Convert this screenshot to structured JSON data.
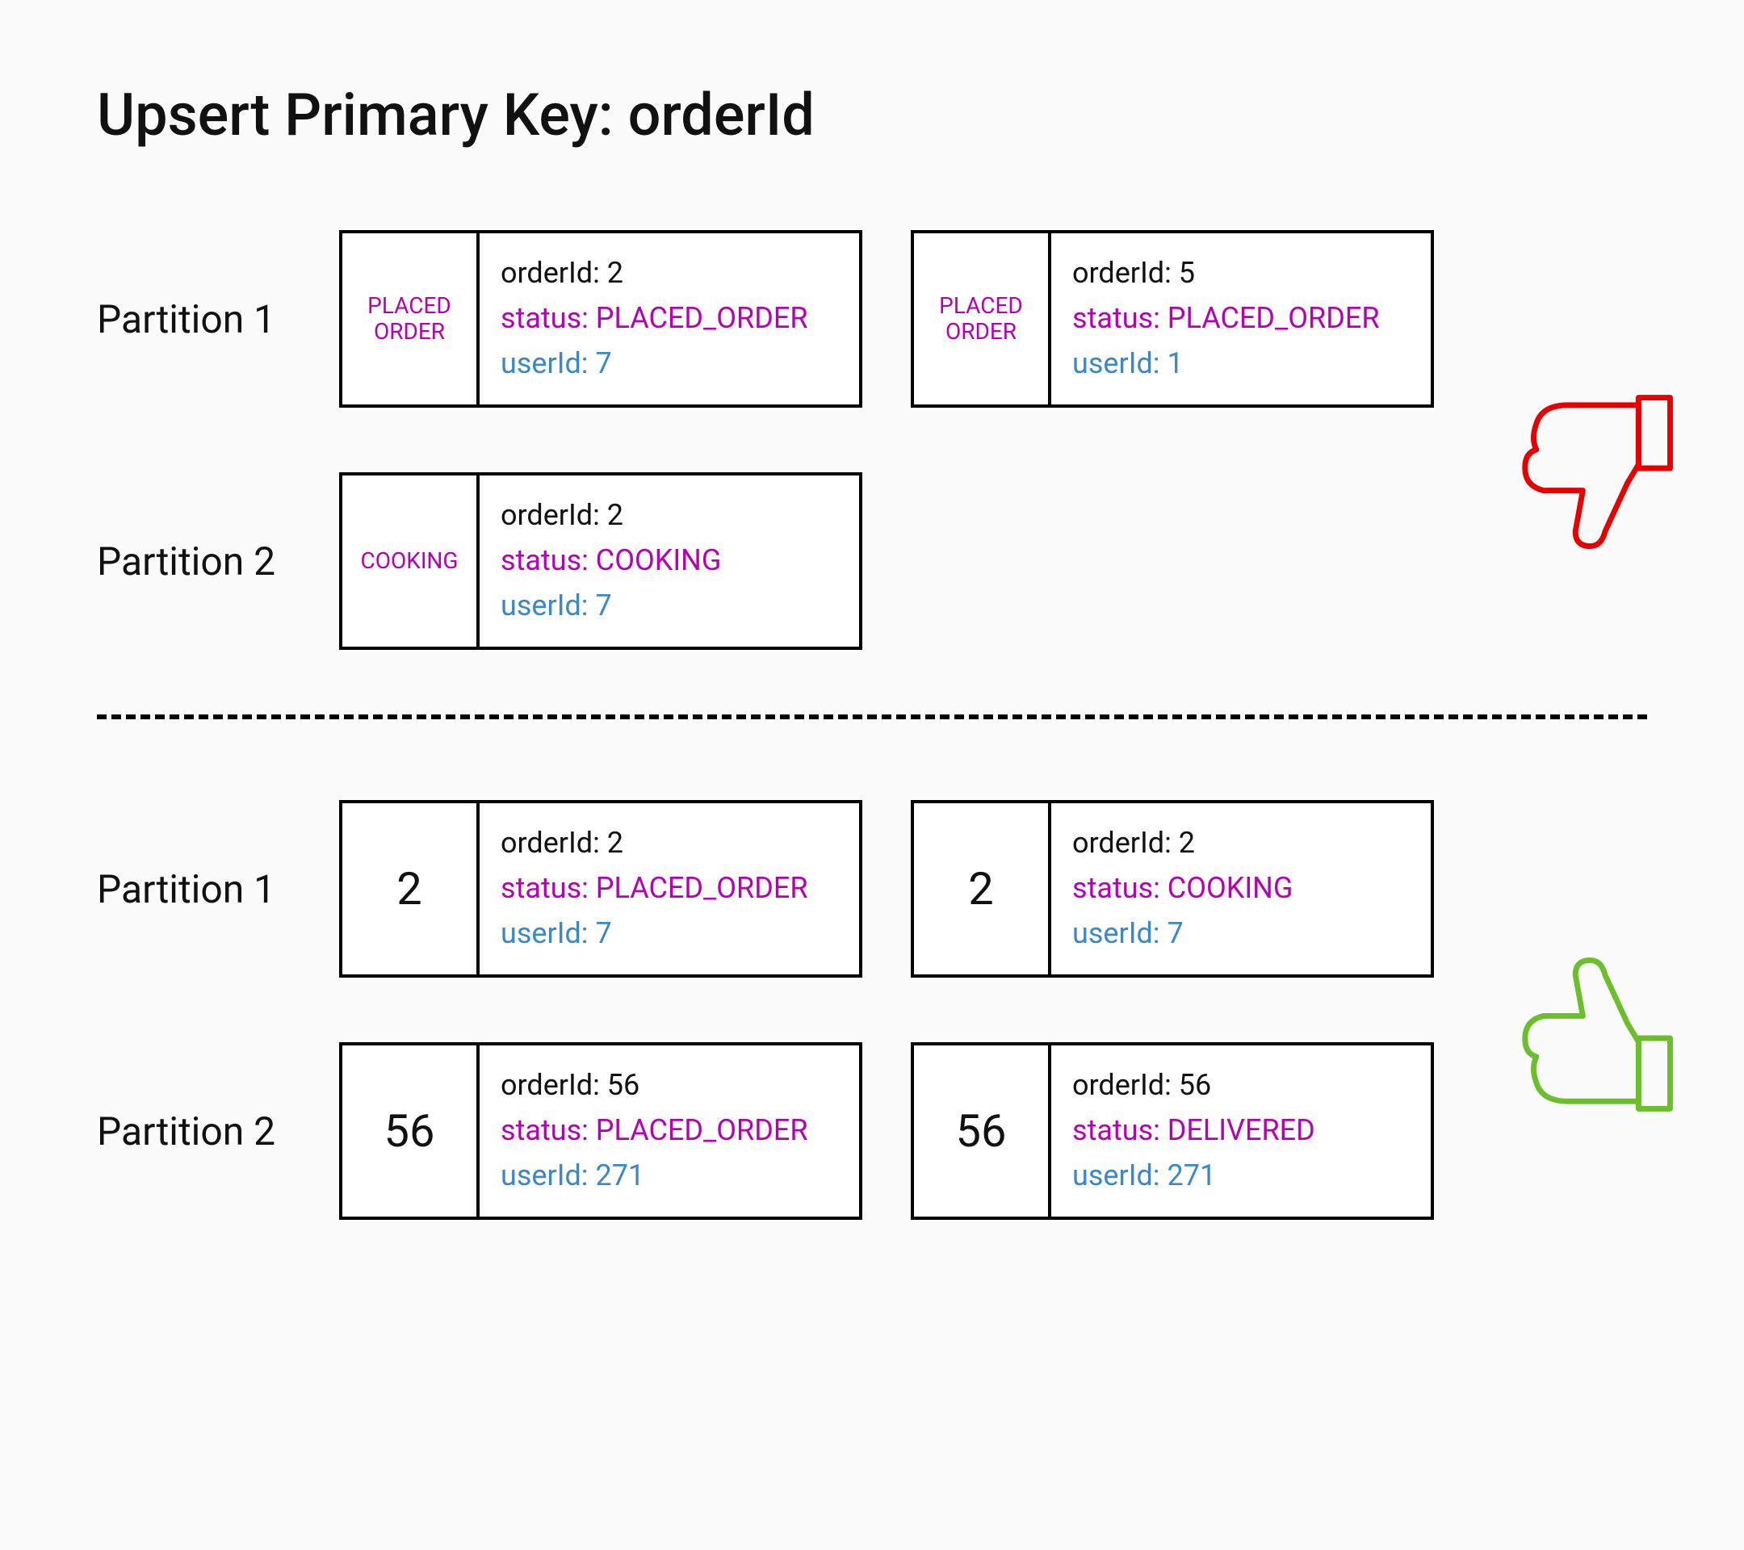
{
  "title": "Upsert Primary Key: orderId",
  "colors": {
    "purple": "#b500b5",
    "blue": "#3b87c8",
    "red": "#e60000",
    "green": "#6abf2a"
  },
  "bad": {
    "icon": "thumbs-down",
    "rows": [
      {
        "label": "Partition 1",
        "cards": [
          {
            "key": "PLACED ORDER",
            "keyStyle": "small",
            "orderId": "orderId: 2",
            "status": "status: PLACED_ORDER",
            "userId": "userId: 7"
          },
          {
            "key": "PLACED ORDER",
            "keyStyle": "small",
            "orderId": "orderId: 5",
            "status": "status: PLACED_ORDER",
            "userId": "userId: 1"
          }
        ]
      },
      {
        "label": "Partition 2",
        "cards": [
          {
            "key": "COOKING",
            "keyStyle": "small",
            "orderId": "orderId: 2",
            "status": "status: COOKING",
            "userId": "userId: 7"
          }
        ]
      }
    ]
  },
  "good": {
    "icon": "thumbs-up",
    "rows": [
      {
        "label": "Partition 1",
        "cards": [
          {
            "key": "2",
            "keyStyle": "big",
            "orderId": "orderId: 2",
            "status": "status: PLACED_ORDER",
            "userId": "userId: 7"
          },
          {
            "key": "2",
            "keyStyle": "big",
            "orderId": "orderId: 2",
            "status": "status: COOKING",
            "userId": "userId: 7"
          }
        ]
      },
      {
        "label": "Partition 2",
        "cards": [
          {
            "key": "56",
            "keyStyle": "big",
            "orderId": "orderId: 56",
            "status": "status: PLACED_ORDER",
            "userId": "userId: 271"
          },
          {
            "key": "56",
            "keyStyle": "big",
            "orderId": "orderId: 56",
            "status": "status: DELIVERED",
            "userId": "userId: 271"
          }
        ]
      }
    ]
  }
}
